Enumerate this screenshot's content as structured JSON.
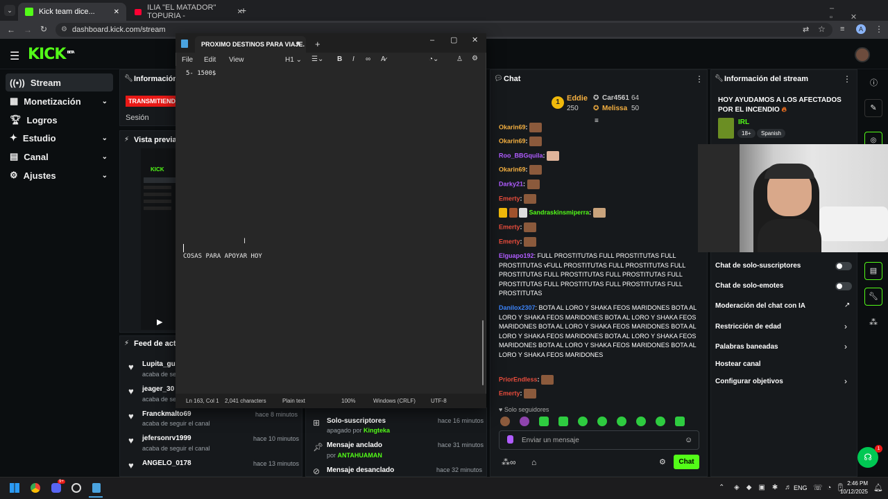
{
  "browser": {
    "tabs": [
      {
        "label": "Kick team dice..."
      },
      {
        "label": "ILIA \"EL MATADOR\" TOPURIA -"
      }
    ],
    "url": "dashboard.kick.com/stream"
  },
  "kick": {
    "logo": "KICK",
    "logo_beta": "BETA",
    "colors": {
      "accent": "#53fc18",
      "bg": "#0b0e10",
      "panel": "#16191c"
    }
  },
  "sidebar": {
    "items": [
      {
        "label": "Stream",
        "icon": "broadcast-icon"
      },
      {
        "label": "Monetización",
        "icon": "money-icon"
      },
      {
        "label": "Logros",
        "icon": "trophy-icon"
      },
      {
        "label": "Estudio",
        "icon": "studio-icon"
      },
      {
        "label": "Canal",
        "icon": "channel-icon"
      },
      {
        "label": "Ajustes",
        "icon": "gear-icon"
      }
    ]
  },
  "info_panel": {
    "title": "Información",
    "live_badge": "TRANSMITIENDO",
    "session": "Sesión",
    "preview_title": "Vista previa d"
  },
  "feed": {
    "title": "Feed de activ",
    "items": [
      {
        "name": "Lupita_gue",
        "sub": "acaba de seg",
        "time": ""
      },
      {
        "name": "jeager_30",
        "sub": "acaba de seg",
        "time": ""
      },
      {
        "name": "Franckmalto69",
        "sub": "acaba de seguir el canal",
        "time": "hace 8 minutos"
      },
      {
        "name": "jefersonrv1999",
        "sub": "acaba de seguir el canal",
        "time": "hace 10 minutos"
      },
      {
        "name": "ANGELO_0178",
        "sub": "",
        "time": "hace 13 minutos"
      }
    ]
  },
  "events": {
    "items": [
      {
        "title": "Solo-suscriptores",
        "sub_prefix": "apagado por ",
        "sub_user": "Kingteka",
        "time": "hace 16 minutos"
      },
      {
        "title": "Mensaje anclado",
        "sub_prefix": "por ",
        "sub_user": "ANTAHUAMAN",
        "time": "hace 31 minutos"
      },
      {
        "title": "Mensaje desanclado",
        "sub_prefix": "",
        "sub_user": "",
        "time": "hace 32 minutos"
      }
    ]
  },
  "notepad": {
    "title": "PROXIMO DESTINOS PARA VIAJE.",
    "menu": [
      "File",
      "Edit",
      "View"
    ],
    "heading_select": "H1",
    "lines": [
      "5- 1500$",
      "COSAS PARA APOYAR HOY"
    ],
    "status": {
      "position": "Ln 163, Col 1",
      "chars": "2,041 characters",
      "format": "Plain text",
      "zoom": "100%",
      "eol": "Windows (CRLF)",
      "encoding": "UTF-8"
    }
  },
  "chat": {
    "title": "Chat",
    "leaderboard": [
      {
        "rank": "1",
        "name": "Eddie",
        "value": "250"
      },
      {
        "name": "Car4561",
        "value": "64"
      },
      {
        "name": "Melissa",
        "value": "50"
      }
    ],
    "messages": [
      {
        "user": "Okarin69",
        "color": "#f5b041"
      },
      {
        "user": "Okarin69",
        "color": "#f5b041"
      },
      {
        "user": "Roo_BBGquila",
        "color": "#b05cff"
      },
      {
        "user": "Okarin69",
        "color": "#f5b041"
      },
      {
        "user": "Darky21",
        "color": "#b05cff"
      },
      {
        "user": "Emerty",
        "color": "#e74c3c"
      },
      {
        "user": "Sandraskinsmiperra",
        "color": "#53fc18"
      },
      {
        "user": "Emerty",
        "color": "#e74c3c"
      },
      {
        "user": "Emerty",
        "color": "#e74c3c"
      }
    ],
    "elguapo": {
      "user": "Elguapo192",
      "color": "#b05cff",
      "text": "FULL PROSTITUTAS FULL PROSTITUTAS FULL PROSTITUTAS vFULL PROSTITUTAS FULL PROSTITUTAS FULL PROSTITUTAS FULL PROSTITUTAS FULL PROSTITUTAS FULL PROSTITUTAS FULL PROSTITUTAS FULL PROSTITUTAS FULL PROSTITUTAS"
    },
    "danilox": {
      "user": "Danilox2307",
      "color": "#3b82f6",
      "text": "BOTA AL LORO Y SHAKA FEOS MARIDONES BOTA AL LORO Y SHAKA FEOS MARIDONES BOTA AL LORO Y SHAKA FEOS MARIDONES BOTA AL LORO Y SHAKA FEOS MARIDONES BOTA AL LORO Y SHAKA FEOS MARIDONES BOTA AL LORO Y SHAKA FEOS MARIDONES BOTA AL LORO Y SHAKA FEOS MARIDONES BOTA AL LORO Y SHAKA FEOS MARIDONES"
    },
    "tail": [
      {
        "user": "PriorEndless",
        "color": "#e74c3c"
      },
      {
        "user": "Emerty",
        "color": "#e74c3c"
      }
    ],
    "mode": "Solo seguidores",
    "input_placeholder": "Enviar un mensaje",
    "send_label": "Chat"
  },
  "stream_info": {
    "title": "Información del stream",
    "stream_title": "HOY AYUDAMOS A LOS AFECTADOS POR EL INCENDIO",
    "category": "IRL",
    "tags": [
      "18+",
      "Spanish"
    ],
    "settings": [
      {
        "label": "Chat de solo-suscriptores",
        "type": "toggle"
      },
      {
        "label": "Chat de solo-emotes",
        "type": "toggle"
      },
      {
        "label": "Moderación del chat con IA",
        "type": "external"
      },
      {
        "label": "Restricción de edad",
        "type": "arrow"
      },
      {
        "label": "Palabras baneadas",
        "type": "arrow"
      },
      {
        "label": "Hostear canal",
        "type": "none"
      },
      {
        "label": "Configurar objetivos",
        "type": "arrow"
      }
    ]
  },
  "notif_badge": "1",
  "taskbar": {
    "lang": "ENG",
    "time": "2:46 PM",
    "date": "10/12/2025",
    "chrome_badge": "9+"
  }
}
